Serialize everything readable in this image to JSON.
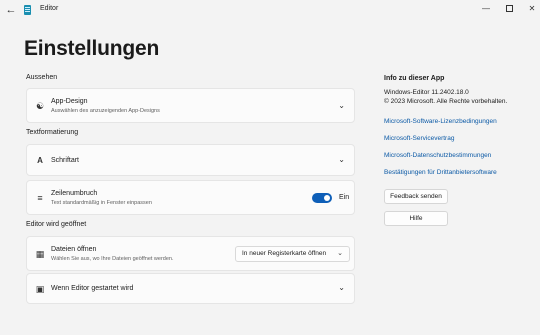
{
  "window": {
    "title": "Editor"
  },
  "page": {
    "title": "Einstellungen"
  },
  "sections": {
    "appearance": "Aussehen",
    "text_formatting": "Textformatierung",
    "editor_opened": "Editor wird geöffnet"
  },
  "cards": {
    "app_design": {
      "label": "App-Design",
      "sub": "Auswählen des anzuzeigenden App-Designs"
    },
    "font": {
      "label": "Schriftart"
    },
    "word_wrap": {
      "label": "Zeilenumbruch",
      "sub": "Text standardmäßig in Fenster einpassen",
      "toggle_label": "Ein",
      "toggle_on": true
    },
    "open_files": {
      "label": "Dateien öffnen",
      "sub": "Wählen Sie aus, wo Ihre Dateien geöffnet werden.",
      "selected": "In neuer Registerkarte öffnen"
    },
    "startup": {
      "label": "Wenn Editor gestartet wird"
    }
  },
  "about": {
    "title": "Info zu dieser App",
    "version": "Windows-Editor 11.2402.18.0",
    "copyright": "© 2023 Microsoft. Alle Rechte vorbehalten.",
    "links": [
      "Microsoft-Software-Lizenzbedingungen",
      "Microsoft-Servicevertrag",
      "Microsoft-Datenschutzbestimmungen",
      "Bestätigungen für Drittanbietersoftware"
    ],
    "feedback_button": "Feedback senden",
    "help_button": "Hilfe"
  },
  "colors": {
    "accent": "#0e5fb8",
    "link": "#0c5aa6",
    "background": "#f3f3f3"
  }
}
